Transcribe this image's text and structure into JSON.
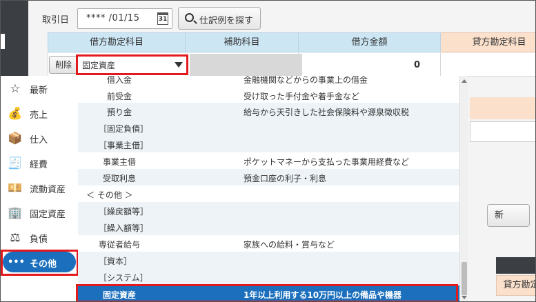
{
  "form": {
    "date_label": "取引日",
    "date_value": "**** /01/15",
    "calendar_icon": "31",
    "search_button": "仕訳例を探す"
  },
  "table": {
    "headers": [
      "借方勘定科目",
      "補助科目",
      "借方金額",
      "貸方勘定科目"
    ],
    "delete_button": "削除",
    "debit_account": "固定資産",
    "debit_amount": "0"
  },
  "background": {
    "partial_button": "新",
    "first_page": "⏮",
    "credit_header2": "貸方勘定科目"
  },
  "categories": [
    {
      "icon": "☆",
      "icon_name": "star-icon",
      "label": "最新"
    },
    {
      "icon": "💰",
      "icon_name": "money-bag-icon",
      "label": "売上"
    },
    {
      "icon": "📦",
      "icon_name": "box-icon",
      "label": "仕入"
    },
    {
      "icon": "🧾",
      "icon_name": "receipt-icon",
      "label": "経費"
    },
    {
      "icon": "💴",
      "icon_name": "cash-icon",
      "label": "流動資産"
    },
    {
      "icon": "🏢",
      "icon_name": "building-icon",
      "label": "固定資産"
    },
    {
      "icon": "⚖",
      "icon_name": "scale-icon",
      "label": "負債"
    },
    {
      "icon": "•••",
      "icon_name": "more-icon",
      "label": "その他"
    }
  ],
  "accounts": [
    {
      "name": "借入金",
      "desc": "金融機関などからの事業上の借金"
    },
    {
      "name": "前受金",
      "desc": "受け取った手付金や着手金など"
    },
    {
      "name": "預り金",
      "desc": "給与から天引きした社会保険料や源泉徴収税"
    },
    {
      "name": "［固定負債］",
      "desc": ""
    },
    {
      "name": "［事業主借］",
      "desc": ""
    },
    {
      "name": "事業主借",
      "desc": "ポケットマネーから支払った事業用経費など"
    },
    {
      "name": "受取利息",
      "desc": "預金口座の利子・利息"
    },
    {
      "name": "＜ その他 ＞",
      "desc": ""
    },
    {
      "name": "［繰戻額等］",
      "desc": ""
    },
    {
      "name": "［繰入額等］",
      "desc": ""
    },
    {
      "name": "専従者給与",
      "desc": "家族への給料・賞与など"
    },
    {
      "name": "［資本］",
      "desc": ""
    },
    {
      "name": "［システム］",
      "desc": ""
    },
    {
      "name": "固定資産",
      "desc": "1年以上利用する10万円以上の備品や機器"
    }
  ]
}
